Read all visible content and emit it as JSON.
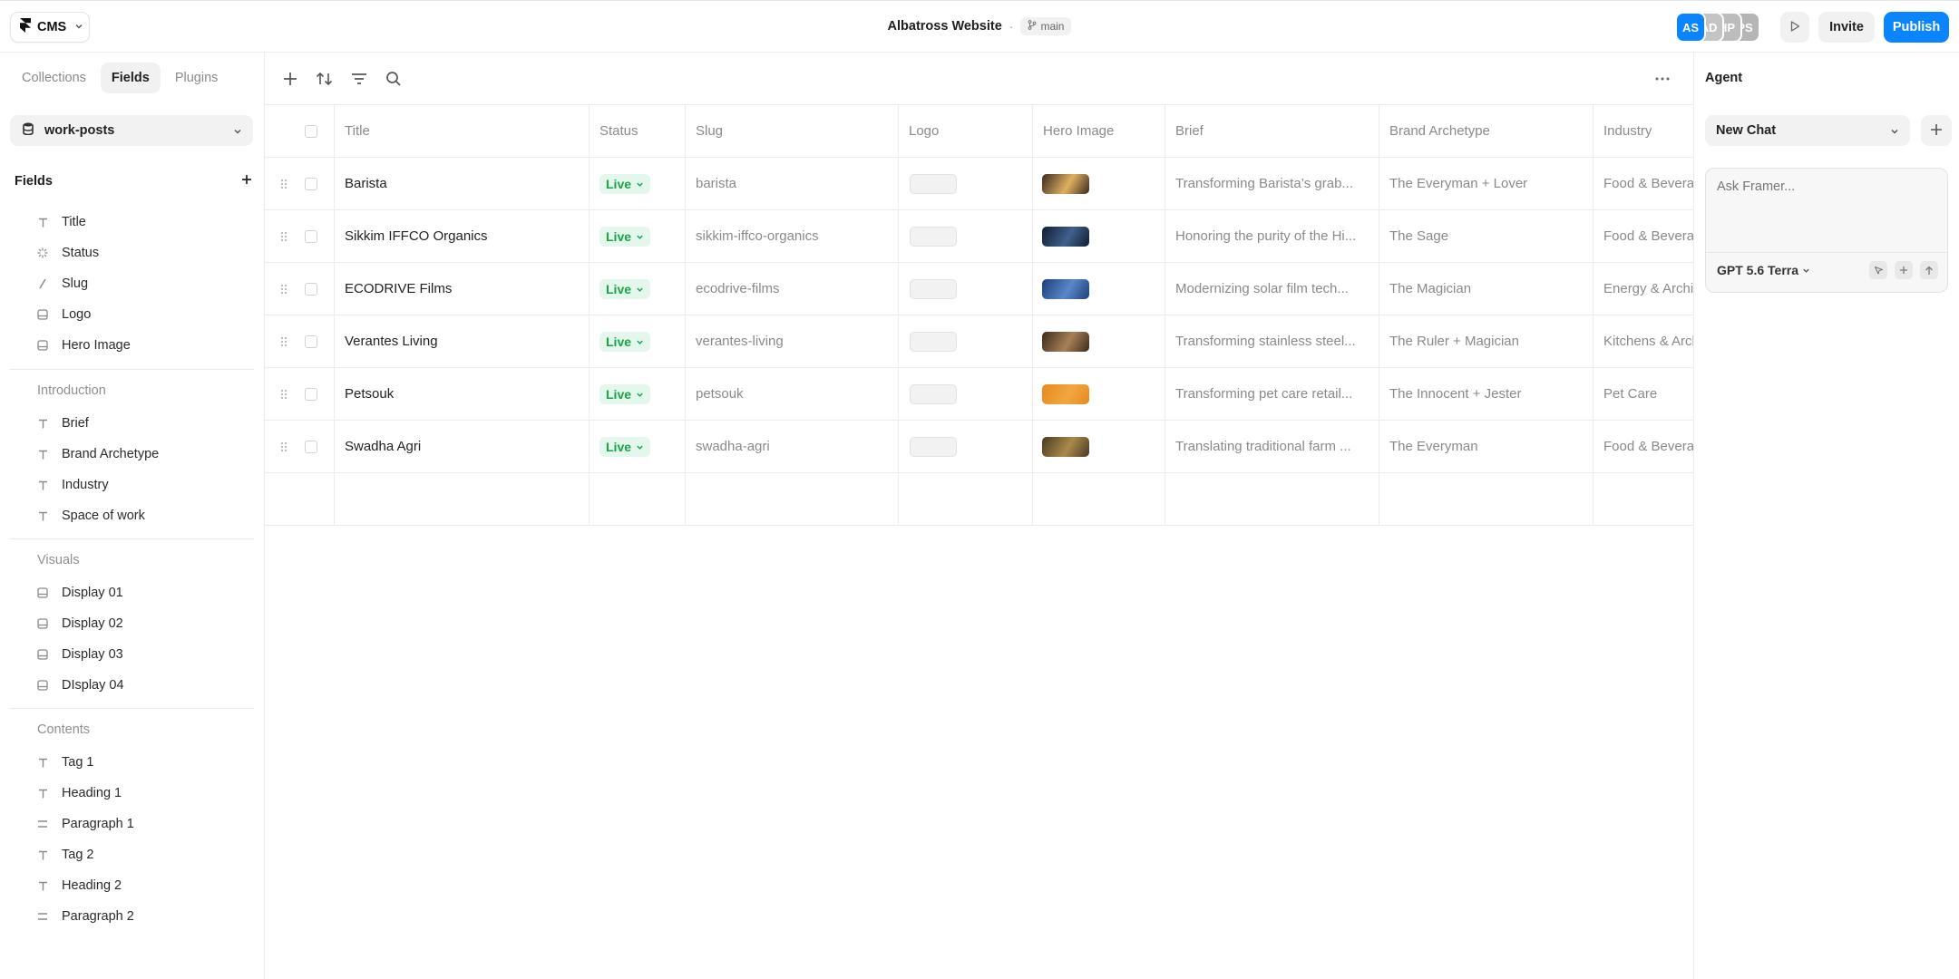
{
  "topbar": {
    "app_label": "CMS",
    "project_title": "Albatross Website",
    "separator": "·",
    "branch": "main",
    "avatars": [
      {
        "initials": "AS",
        "color": "#0a84ff"
      },
      {
        "initials": "AD",
        "color": "#b9b9b9"
      },
      {
        "initials": "HP",
        "color": "#b3b3b3"
      },
      {
        "initials": "PS",
        "color": "#aeaeae"
      }
    ],
    "invite_label": "Invite",
    "publish_label": "Publish",
    "accent_color": "#0a84ff"
  },
  "sidebar": {
    "tabs": [
      {
        "label": "Collections",
        "active": false
      },
      {
        "label": "Fields",
        "active": true
      },
      {
        "label": "Plugins",
        "active": false
      }
    ],
    "collection": "work-posts",
    "fields_heading": "Fields",
    "top_fields": [
      {
        "label": "Title",
        "icon": "text-icon"
      },
      {
        "label": "Status",
        "icon": "loader-icon"
      },
      {
        "label": "Slug",
        "icon": "slash-icon"
      },
      {
        "label": "Logo",
        "icon": "image-icon"
      },
      {
        "label": "Hero Image",
        "icon": "image-icon"
      }
    ],
    "groups": [
      {
        "label": "Introduction",
        "items": [
          {
            "label": "Brief",
            "icon": "text-icon"
          },
          {
            "label": "Brand Archetype",
            "icon": "text-icon"
          },
          {
            "label": "Industry",
            "icon": "text-icon"
          },
          {
            "label": "Space of work",
            "icon": "text-icon"
          }
        ]
      },
      {
        "label": "Visuals",
        "items": [
          {
            "label": "Display 01",
            "icon": "image-icon"
          },
          {
            "label": "Display 02",
            "icon": "image-icon"
          },
          {
            "label": "Display 03",
            "icon": "image-icon"
          },
          {
            "label": "DIsplay 04",
            "icon": "image-icon"
          }
        ]
      },
      {
        "label": "Contents",
        "items": [
          {
            "label": "Tag 1",
            "icon": "text-icon"
          },
          {
            "label": "Heading 1",
            "icon": "text-icon"
          },
          {
            "label": "Paragraph 1",
            "icon": "paragraph-icon"
          },
          {
            "label": "Tag 2",
            "icon": "text-icon"
          },
          {
            "label": "Heading 2",
            "icon": "text-icon"
          },
          {
            "label": "Paragraph 2",
            "icon": "paragraph-icon"
          }
        ]
      }
    ]
  },
  "table": {
    "columns": [
      "Title",
      "Status",
      "Slug",
      "Logo",
      "Hero Image",
      "Brief",
      "Brand Archetype",
      "Industry"
    ],
    "status_color": "#19a34a",
    "rows": [
      {
        "title": "Barista",
        "status": "Live",
        "slug": "barista",
        "brief": "Transforming Barista’s grab...",
        "archetype": "The Everyman + Lover",
        "industry": "Food & Beverages",
        "hero_colors": [
          "#3a2a1e",
          "#e0b060"
        ]
      },
      {
        "title": "Sikkim IFFCO Organics",
        "status": "Live",
        "slug": "sikkim-iffco-organics",
        "brief": "Honoring the purity of the Hi...",
        "archetype": "The Sage",
        "industry": "Food & Beverages",
        "hero_colors": [
          "#0f1d33",
          "#41608c"
        ]
      },
      {
        "title": "ECODRIVE Films",
        "status": "Live",
        "slug": "ecodrive-films",
        "brief": "Modernizing solar film tech...",
        "archetype": "The Magician",
        "industry": "Energy & Architecture",
        "hero_colors": [
          "#1c3f7a",
          "#5a87c7"
        ]
      },
      {
        "title": "Verantes Living",
        "status": "Live",
        "slug": "verantes-living",
        "brief": "Transforming stainless steel...",
        "archetype": "The Ruler + Magician",
        "industry": "Kitchens & Architecture",
        "hero_colors": [
          "#3b2a1a",
          "#a88058"
        ]
      },
      {
        "title": "Petsouk",
        "status": "Live",
        "slug": "petsouk",
        "brief": "Transforming pet care retail...",
        "archetype": "The Innocent + Jester",
        "industry": "Pet Care",
        "hero_colors": [
          "#e58a1e",
          "#f2a640"
        ]
      },
      {
        "title": "Swadha Agri",
        "status": "Live",
        "slug": "swadha-agri",
        "brief": "Translating traditional farm ...",
        "archetype": "The Everyman",
        "industry": "Food & Beverages",
        "hero_colors": [
          "#4a3a22",
          "#a98a4a"
        ]
      }
    ]
  },
  "agent": {
    "title": "Agent",
    "chat_select": "New Chat",
    "ask_placeholder": "Ask Framer...",
    "model": "GPT 5.6 Terra"
  }
}
